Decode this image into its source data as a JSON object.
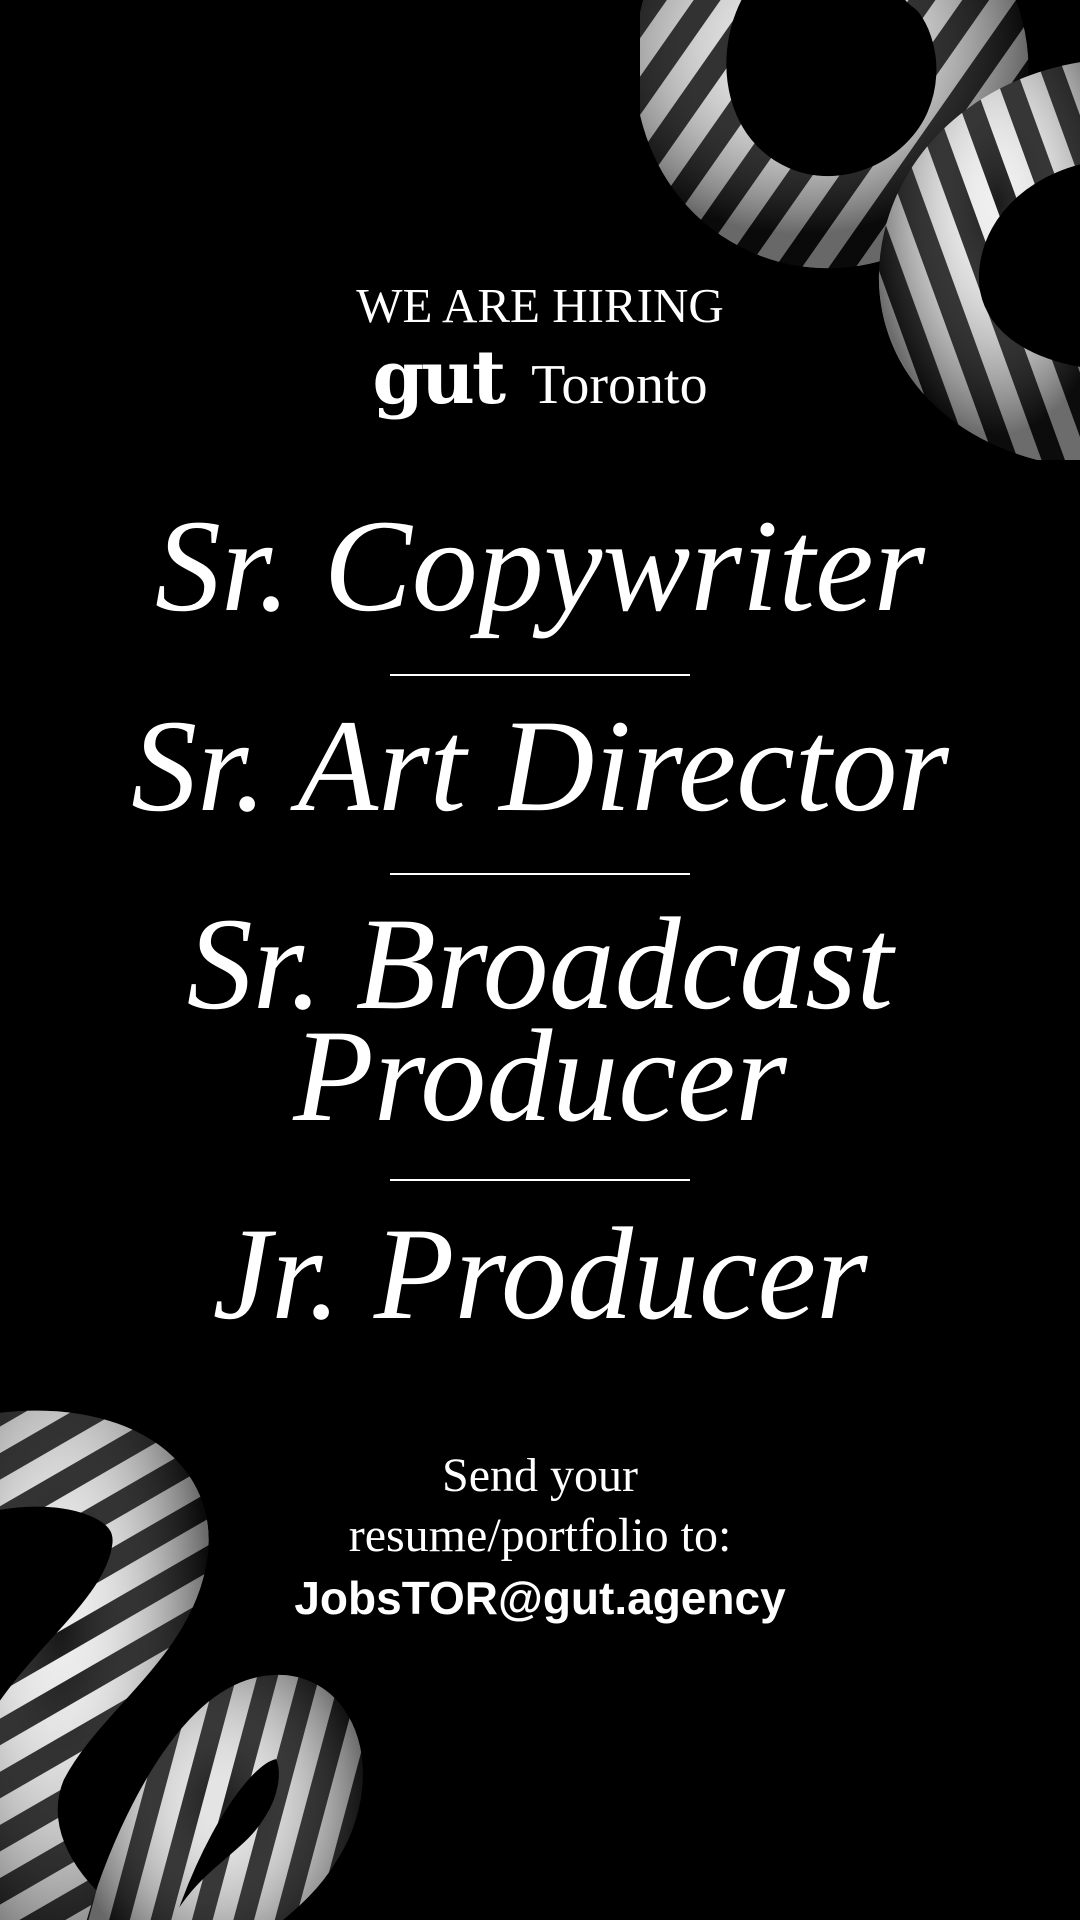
{
  "header": {
    "hiring_text": "WE ARE HIRING",
    "brand_logo": "gut",
    "city": "Toronto"
  },
  "jobs": {
    "items": [
      "Sr. Copywriter",
      "Sr. Art Director",
      "Sr. Broadcast Producer",
      "Jr. Producer"
    ],
    "line_3a": "Sr. Broadcast",
    "line_3b": "Producer"
  },
  "cta": {
    "line_1": "Send your",
    "line_2": "resume/portfolio to:",
    "email": "JobsTOR@gut.agency"
  },
  "colors": {
    "background": "#000000",
    "text": "#ffffff",
    "stripe_dark": "#1a1a1a",
    "stripe_light": "#e8e8e8"
  },
  "icons": {
    "decoration_top": "striped-tube-icon",
    "decoration_bottom": "striped-tube-icon"
  }
}
